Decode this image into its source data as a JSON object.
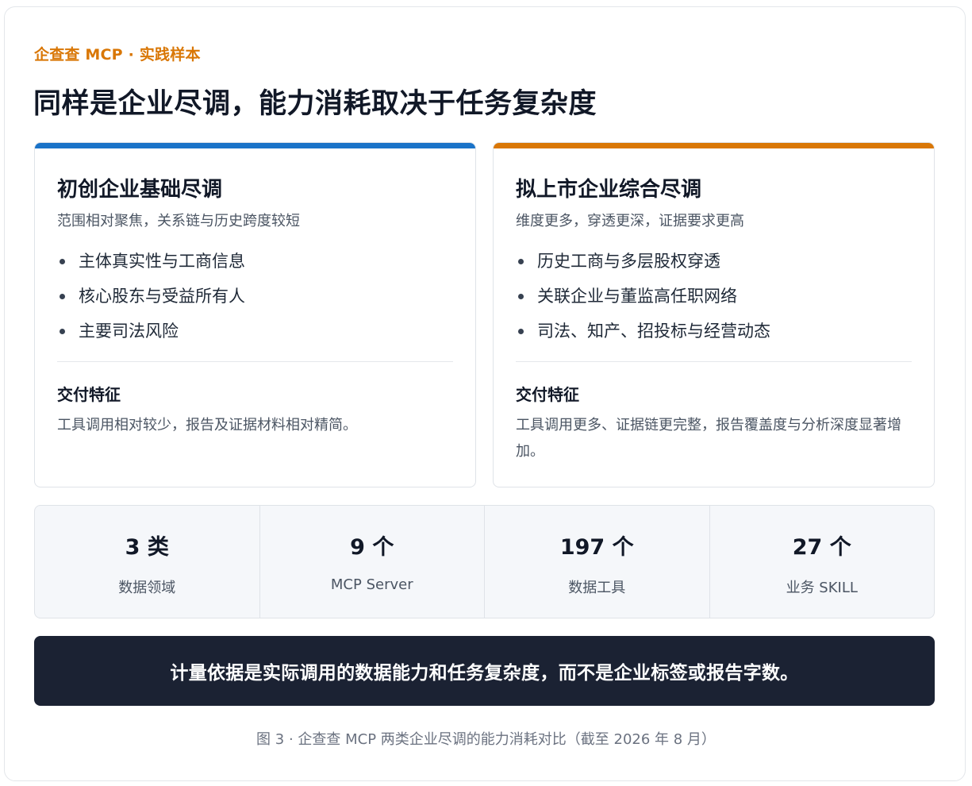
{
  "header": {
    "eyebrow": "企查查 MCP · 实践样本",
    "title": "同样是企业尽调，能力消耗取决于任务复杂度"
  },
  "colors": {
    "accent_blue": "#1a73c8",
    "accent_orange": "#d97706",
    "banner_bg": "#1b2233"
  },
  "cards": [
    {
      "title": "初创企业基础尽调",
      "subtitle": "范围相对聚焦，关系链与历史跨度较短",
      "bullets": [
        "主体真实性与工商信息",
        "核心股东与受益所有人",
        "主要司法风险"
      ],
      "feature_title": "交付特征",
      "feature_text": "工具调用相对较少，报告及证据材料相对精简。"
    },
    {
      "title": "拟上市企业综合尽调",
      "subtitle": "维度更多，穿透更深，证据要求更高",
      "bullets": [
        "历史工商与多层股权穿透",
        "关联企业与董监高任职网络",
        "司法、知产、招投标与经营动态"
      ],
      "feature_title": "交付特征",
      "feature_text": "工具调用更多、证据链更完整，报告覆盖度与分析深度显著增加。"
    }
  ],
  "stats": [
    {
      "value": "3 类",
      "label": "数据领域"
    },
    {
      "value": "9 个",
      "label": "MCP Server"
    },
    {
      "value": "197 个",
      "label": "数据工具"
    },
    {
      "value": "27 个",
      "label": "业务 SKILL"
    }
  ],
  "banner": "计量依据是实际调用的数据能力和任务复杂度，而不是企业标签或报告字数。",
  "caption": "图 3 · 企查查 MCP 两类企业尽调的能力消耗对比（截至 2026 年 8 月）"
}
